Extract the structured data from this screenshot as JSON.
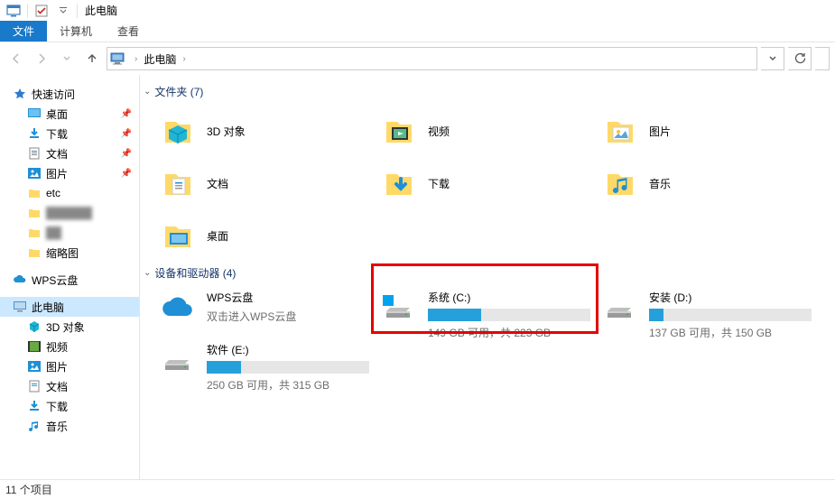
{
  "titlebar": {
    "title": "此电脑"
  },
  "ribbon": {
    "file": "文件",
    "computer": "计算机",
    "view": "查看"
  },
  "address": {
    "root": "此电脑"
  },
  "sidebar": {
    "quick_access": "快速访问",
    "desktop": "桌面",
    "downloads": "下载",
    "documents": "文档",
    "pictures": "图片",
    "etc": "etc",
    "redacted1": "██████",
    "redacted2": "██",
    "thumbnails": "缩略图",
    "wps": "WPS云盘",
    "this_pc": "此电脑",
    "objects3d": "3D 对象",
    "videos": "视频",
    "pictures2": "图片",
    "documents2": "文档",
    "downloads2": "下载",
    "music": "音乐"
  },
  "sections": {
    "folders_header": "文件夹 (7)",
    "drives_header": "设备和驱动器 (4)"
  },
  "folders": {
    "objects3d": "3D 对象",
    "videos": "视频",
    "pictures": "图片",
    "documents": "文档",
    "downloads": "下载",
    "music": "音乐",
    "desktop": "桌面"
  },
  "drives": {
    "wps": {
      "name": "WPS云盘",
      "sub": "双击进入WPS云盘"
    },
    "c": {
      "name": "系统 (C:)",
      "sub": "149 GB 可用，共 223 GB",
      "fill_pct": 33
    },
    "d": {
      "name": "安装 (D:)",
      "sub": "137 GB 可用，共 150 GB",
      "fill_pct": 9
    },
    "e": {
      "name": "软件 (E:)",
      "sub": "250 GB 可用，共 315 GB",
      "fill_pct": 21
    }
  },
  "statusbar": {
    "count": "11 个项目"
  }
}
